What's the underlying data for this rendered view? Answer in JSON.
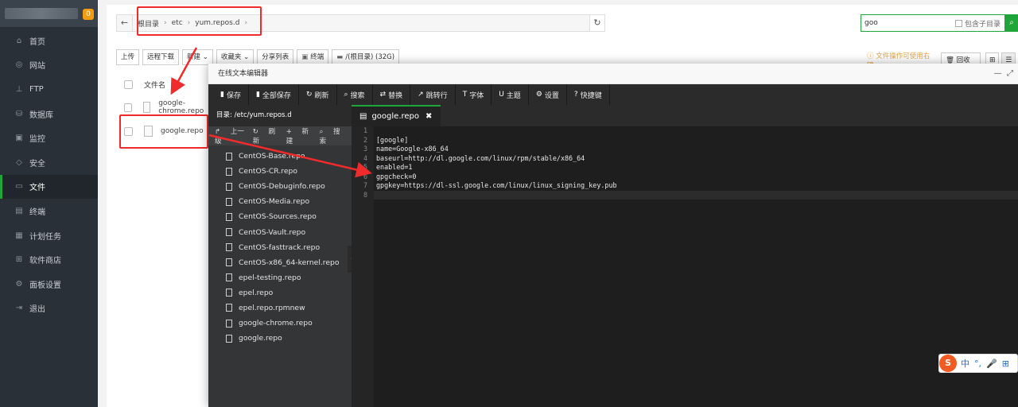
{
  "sidebar": {
    "badge": "0",
    "items": [
      {
        "icon": "home-icon",
        "glyph": "⌂",
        "label": "首页"
      },
      {
        "icon": "globe-icon",
        "glyph": "◎",
        "label": "网站"
      },
      {
        "icon": "ftp-icon",
        "glyph": "⊥",
        "label": "FTP"
      },
      {
        "icon": "database-icon",
        "glyph": "⛁",
        "label": "数据库"
      },
      {
        "icon": "monitor-icon",
        "glyph": "▣",
        "label": "监控"
      },
      {
        "icon": "shield-icon",
        "glyph": "◇",
        "label": "安全"
      },
      {
        "icon": "folder-icon",
        "glyph": "▭",
        "label": "文件"
      },
      {
        "icon": "terminal-icon",
        "glyph": "▤",
        "label": "终端"
      },
      {
        "icon": "task-icon",
        "glyph": "▦",
        "label": "计划任务"
      },
      {
        "icon": "store-icon",
        "glyph": "⊞",
        "label": "软件商店"
      },
      {
        "icon": "settings-icon",
        "glyph": "⚙",
        "label": "面板设置"
      },
      {
        "icon": "logout-icon",
        "glyph": "⇥",
        "label": "退出"
      }
    ],
    "active_index": 6
  },
  "filemanager": {
    "breadcrumb": [
      "根目录",
      "etc",
      "yum.repos.d"
    ],
    "search_value": "goo",
    "include_subdir": "包含子目录",
    "toolbar": [
      "上传",
      "远程下载",
      "新建",
      "收藏夹",
      "分享列表",
      "终端",
      "/(根目录) (32G)"
    ],
    "tip": "文件操作可使用右键",
    "recycle": "回收站",
    "column_name": "文件名",
    "files": [
      "google-chrome.repo",
      "google.repo"
    ]
  },
  "editor": {
    "title": "在线文本编辑器",
    "toolbar": [
      {
        "icon": "save-icon",
        "glyph": "▮",
        "label": "保存"
      },
      {
        "icon": "save-all-icon",
        "glyph": "▮",
        "label": "全部保存"
      },
      {
        "icon": "refresh-icon",
        "glyph": "↻",
        "label": "刷新"
      },
      {
        "icon": "search-icon",
        "glyph": "⌕",
        "label": "搜索"
      },
      {
        "icon": "replace-icon",
        "glyph": "⇄",
        "label": "替换"
      },
      {
        "icon": "goto-icon",
        "glyph": "↗",
        "label": "跳转行"
      },
      {
        "icon": "font-icon",
        "glyph": "T",
        "label": "字体"
      },
      {
        "icon": "theme-icon",
        "glyph": "U",
        "label": "主题"
      },
      {
        "icon": "settings-icon",
        "glyph": "⚙",
        "label": "设置"
      },
      {
        "icon": "help-icon",
        "glyph": "?",
        "label": "快捷键"
      }
    ],
    "directory": "目录: /etc/yum.repos.d",
    "tree_ops": [
      "上一级",
      "刷新",
      "新建",
      "搜索"
    ],
    "tree_files": [
      "CentOS-Base.repo",
      "CentOS-CR.repo",
      "CentOS-Debuginfo.repo",
      "CentOS-Media.repo",
      "CentOS-Sources.repo",
      "CentOS-Vault.repo",
      "CentOS-fasttrack.repo",
      "CentOS-x86_64-kernel.repo",
      "epel-testing.repo",
      "epel.repo",
      "epel.repo.rpmnew",
      "google-chrome.repo",
      "google.repo"
    ],
    "tab_name": "google.repo",
    "line_numbers": [
      "1",
      "2",
      "3",
      "4",
      "5",
      "6",
      "7",
      "8"
    ],
    "code_lines": [
      "",
      "[google]",
      "name=Google-x86_64",
      "baseurl=http://dl.google.com/linux/rpm/stable/x86_64",
      "enabled=1",
      "gpgcheck=0",
      "gpgkey=https://dl-ssl.google.com/linux/linux_signing_key.pub",
      ""
    ]
  },
  "ime": {
    "zh": "中",
    "punct": "°,",
    "mic": "🎤",
    "kb": "⊞"
  },
  "colors": {
    "accent": "#20a53a",
    "annotation": "#f02b2b",
    "sidebar": "#293038"
  }
}
